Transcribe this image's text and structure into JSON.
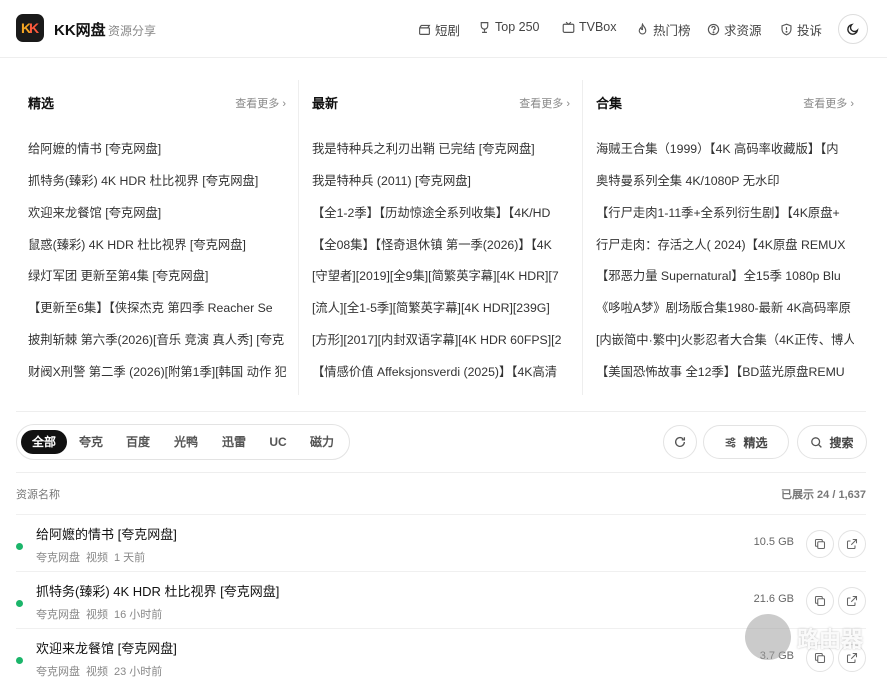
{
  "header": {
    "brand": "KK网盘",
    "brand_sub": "资源分享",
    "logo_text": "KK",
    "nav": [
      {
        "label": "短剧",
        "icon": "clapper-icon"
      },
      {
        "label": "Top 250",
        "icon": "trophy-icon"
      },
      {
        "label": "TVBox",
        "icon": "tv-icon"
      },
      {
        "label": "热门榜",
        "icon": "flame-icon"
      },
      {
        "label": "求资源",
        "icon": "help-icon"
      },
      {
        "label": "投诉",
        "icon": "shield-icon"
      }
    ],
    "theme_icon": "moon-icon"
  },
  "columns": [
    {
      "title": "精选",
      "more": "查看更多",
      "items": [
        "给阿嬷的情书 [夸克网盘]",
        "抓特务(臻彩) 4K HDR 杜比视界 [夸克网盘]",
        "欢迎来龙餐馆 [夸克网盘]",
        "鼠惑(臻彩) 4K HDR 杜比视界 [夸克网盘]",
        "绿灯军团 更新至第4集 [夸克网盘]",
        "【更新至6集】【侠探杰克 第四季 Reacher Se",
        "披荆斩棘 第六季(2026)[音乐 竞演 真人秀] [夸克",
        "财阀X刑警 第二季 (2026)[附第1季][韩国 动作 犯"
      ]
    },
    {
      "title": "最新",
      "more": "查看更多",
      "items": [
        "我是特种兵之利刃出鞘 已完结 [夸克网盘]",
        "我是特种兵 (2011) [夸克网盘]",
        "【全1-2季】【历劫惊途全系列收集】【4K/HD",
        "【全08集】【怪奇退休镇 第一季(2026)】【4K",
        "[守望者][2019][全9集][简繁英字幕][4K HDR][7",
        "[流人][全1-5季][简繁英字幕][4K HDR][239G]",
        "[方形][2017][内封双语字幕][4K HDR 60FPS][2",
        "【情感价值 Affeksjonsverdi (2025)】【4K高清"
      ]
    },
    {
      "title": "合集",
      "more": "查看更多",
      "items": [
        "海贼王合集（1999）【4K 高码率收藏版】【内",
        "奥特曼系列全集 4K/1080P 无水印",
        "【行尸走肉1-11季+全系列衍生剧】【4K原盘+",
        "行尸走肉：存活之人( 2024)【4K原盘 REMUX",
        "【邪恶力量 Supernatural】全15季 1080p Blu",
        "《哆啦A梦》剧场版合集1980-最新 4K高码率原",
        "[内嵌简中·繁中]火影忍者大合集（4K正传、博人",
        "【美国恐怖故事 全12季】【BD蓝光原盘REMU"
      ]
    }
  ],
  "filter_tabs": [
    "全部",
    "夸克",
    "百度",
    "光鸭",
    "迅雷",
    "UC",
    "磁力"
  ],
  "active_tab": "全部",
  "actions": {
    "refresh_icon": "refresh-icon",
    "filter_label": "精选",
    "search_label": "搜索"
  },
  "table": {
    "header_name": "资源名称",
    "count_text": "已展示 24 / 1,637",
    "rows": [
      {
        "title": "给阿嬷的情书 [夸克网盘]",
        "source": "夸克网盘",
        "type": "视频",
        "time": "1 天前",
        "size": "10.5 GB"
      },
      {
        "title": "抓特务(臻彩) 4K HDR 杜比视界 [夸克网盘]",
        "source": "夸克网盘",
        "type": "视频",
        "time": "16 小时前",
        "size": "21.6 GB"
      },
      {
        "title": "欢迎来龙餐馆 [夸克网盘]",
        "source": "夸克网盘",
        "type": "视频",
        "time": "23 小时前",
        "size": "3.7 GB"
      }
    ]
  },
  "watermark": "路由器",
  "colors": {
    "accent_dark": "#111111",
    "online_dot": "#1bb56a",
    "logo_orange": "#f5a623",
    "logo_red": "#ff5a3c"
  }
}
